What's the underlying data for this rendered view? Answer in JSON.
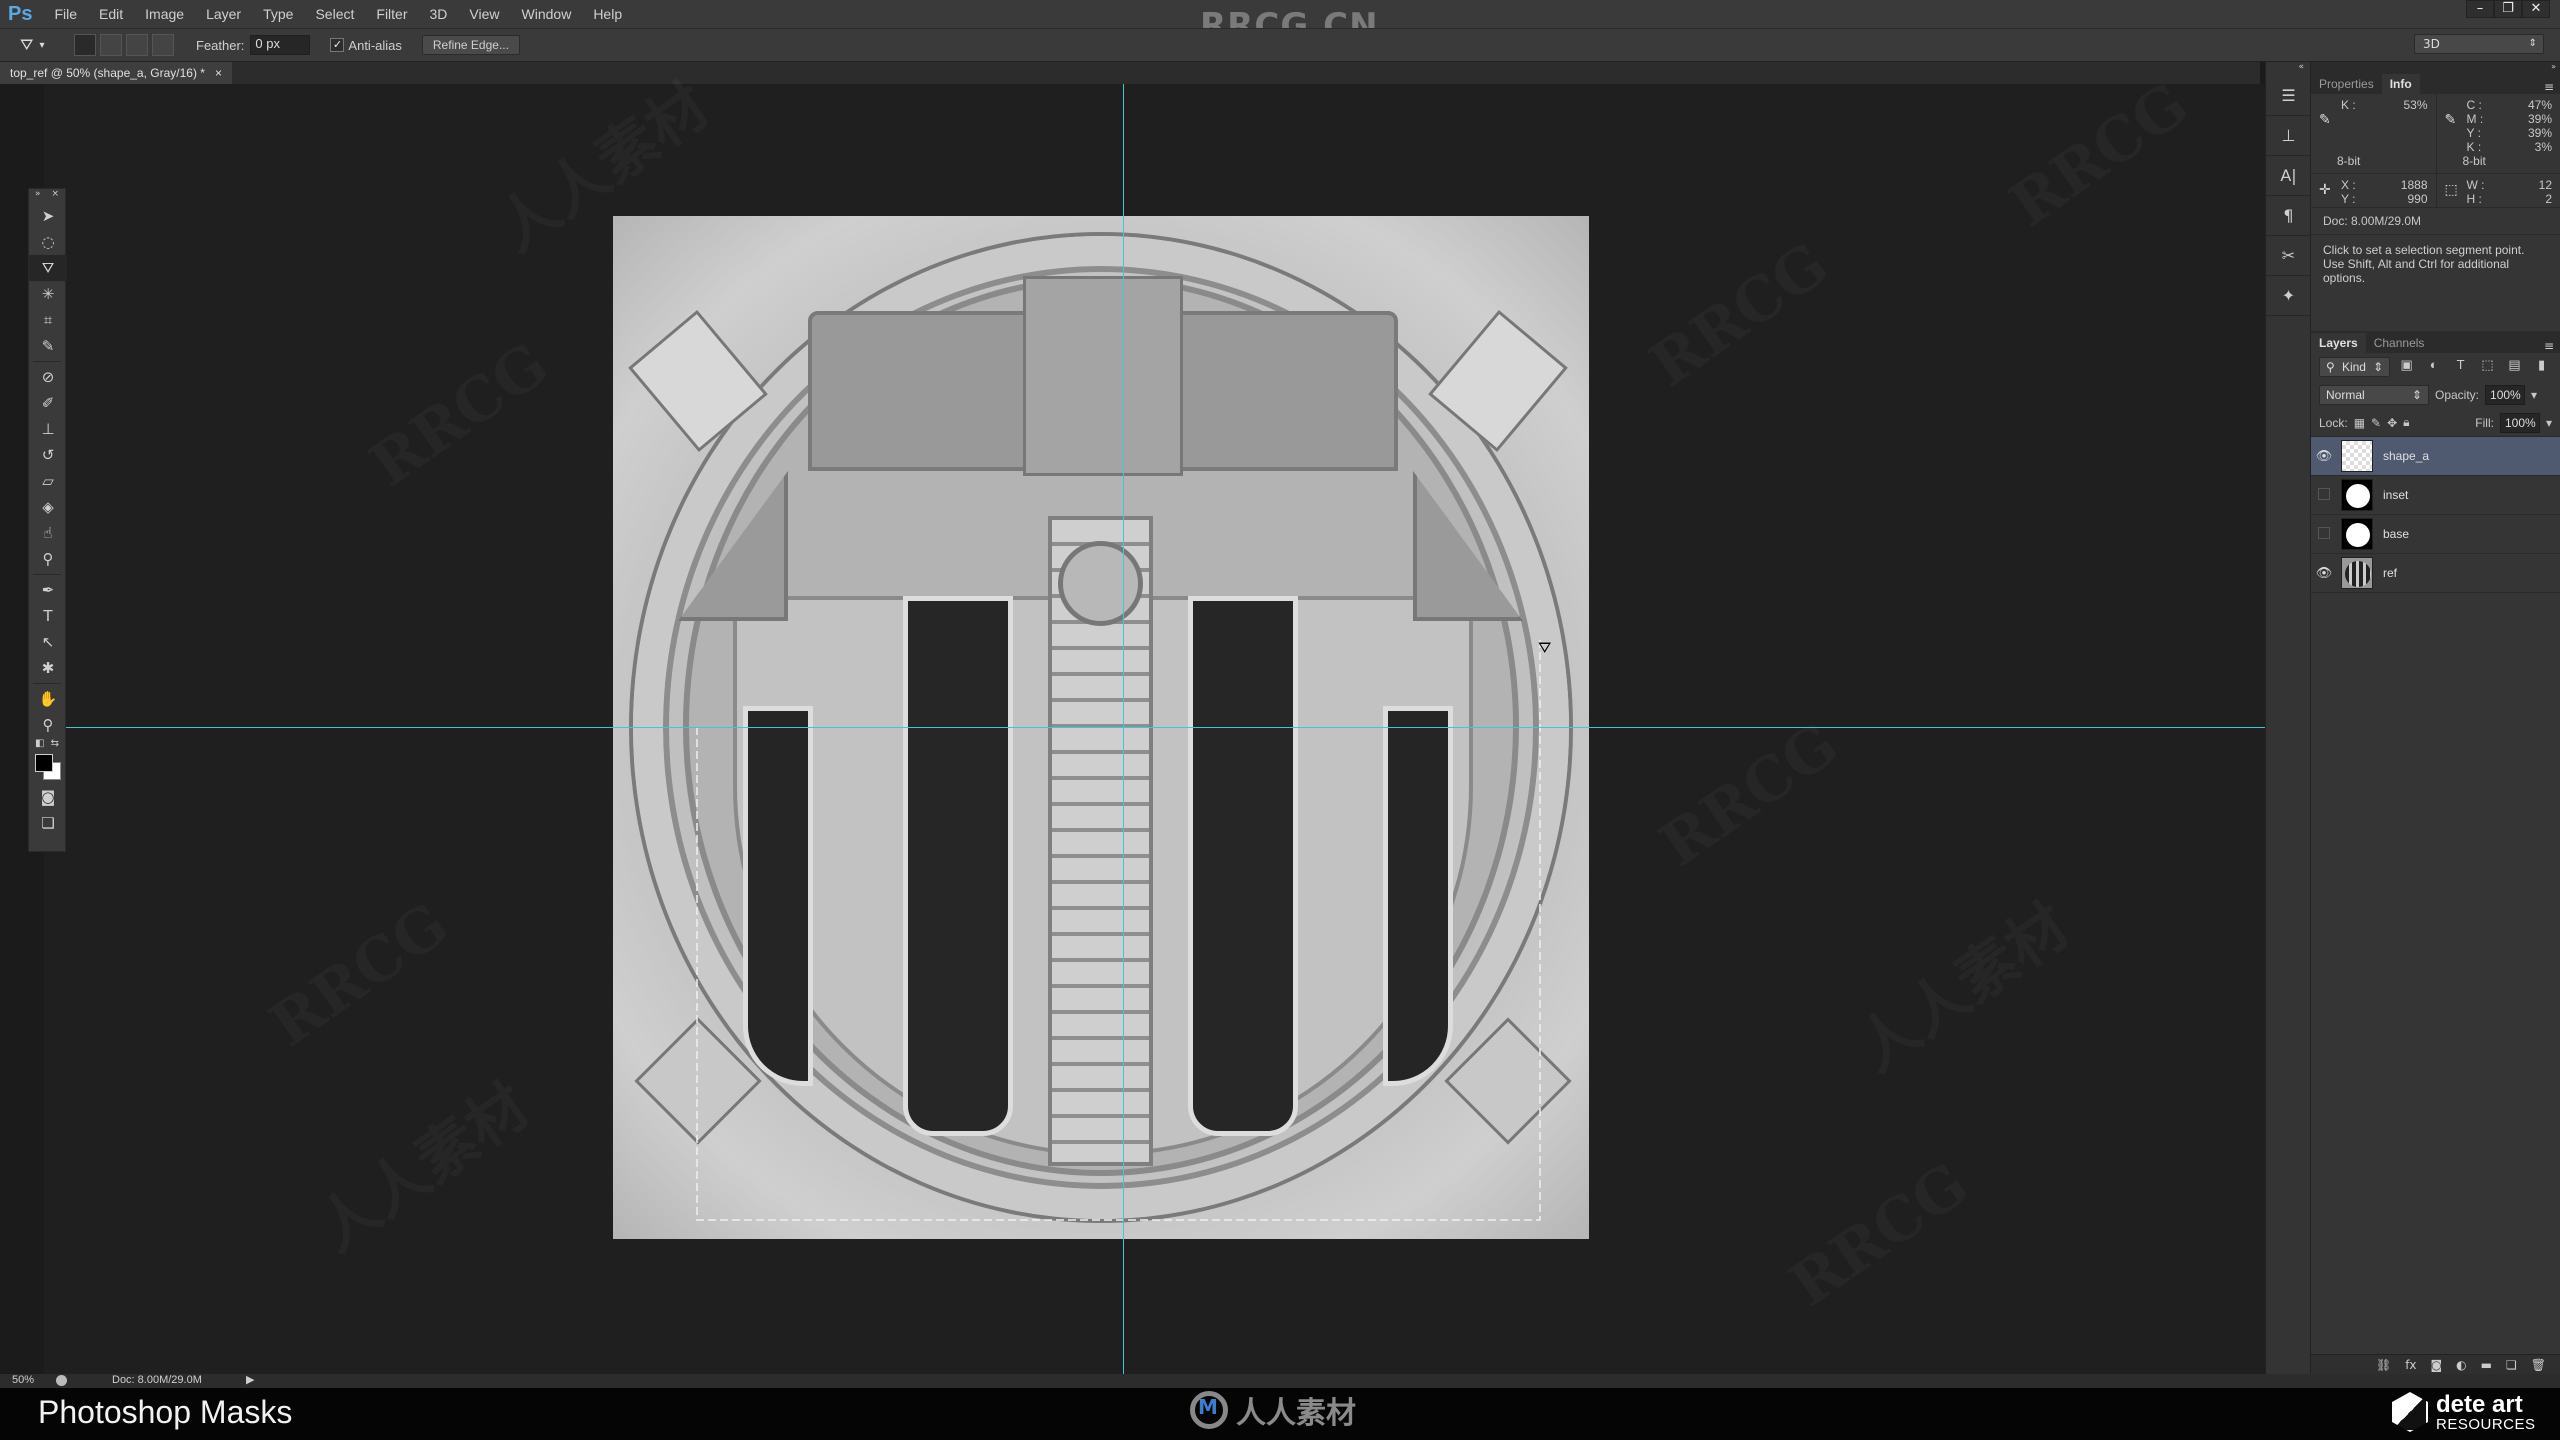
{
  "app": {
    "logo": "Ps",
    "watermark": "RRCG.CN"
  },
  "menu": [
    "File",
    "Edit",
    "Image",
    "Layer",
    "Type",
    "Select",
    "Filter",
    "3D",
    "View",
    "Window",
    "Help"
  ],
  "window_controls": {
    "minimize": "–",
    "restore": "❐",
    "close": "✕"
  },
  "options_bar": {
    "tool_icon": "polygonal-lasso-icon",
    "feather_label": "Feather:",
    "feather_value": "0 px",
    "antialias_label": "Anti-alias",
    "antialias_checked": true,
    "refine_edge_label": "Refine Edge...",
    "workspace": "3D"
  },
  "document_tab": {
    "title": "top_ref @ 50% (shape_a, Gray/16) *",
    "close": "×"
  },
  "toolbox": {
    "tools": [
      "move",
      "elliptical-marquee",
      "polygonal-lasso",
      "magic-wand",
      "crop",
      "eyedropper",
      "spot-healing",
      "brush",
      "clone-stamp",
      "history-brush",
      "eraser",
      "paint-bucket",
      "smudge",
      "dodge",
      "pen",
      "type",
      "path-selection",
      "custom-shape",
      "hand",
      "zoom"
    ],
    "active_tool": "polygonal-lasso",
    "foreground_color": "#000000",
    "background_color": "#ffffff"
  },
  "info_panel": {
    "tabs": [
      "Properties",
      "Info"
    ],
    "active_tab": "Info",
    "gray": {
      "K": "53%",
      "bit": "8-bit"
    },
    "cmyk": {
      "C": "47%",
      "M": "39%",
      "Y": "39%",
      "K": "3%",
      "bit": "8-bit"
    },
    "position": {
      "X": "1888",
      "Y": "990"
    },
    "size": {
      "W": "12",
      "H": "2"
    },
    "doc": "Doc: 8.00M/29.0M",
    "hint": "Click to set a selection segment point. Use Shift, Alt and Ctrl for additional options."
  },
  "layers_panel": {
    "tabs": [
      "Layers",
      "Channels"
    ],
    "active_tab": "Layers",
    "filter": "Kind",
    "blend_mode": "Normal",
    "opacity_label": "Opacity:",
    "opacity": "100%",
    "lock_label": "Lock:",
    "fill_label": "Fill:",
    "fill": "100%",
    "layers": [
      {
        "name": "shape_a",
        "visible": true,
        "selected": true,
        "thumb": "transparent"
      },
      {
        "name": "inset",
        "visible": false,
        "selected": false,
        "thumb": "mask"
      },
      {
        "name": "base",
        "visible": false,
        "selected": false,
        "thumb": "mask"
      },
      {
        "name": "ref",
        "visible": true,
        "selected": false,
        "thumb": "image"
      }
    ]
  },
  "status_bar": {
    "zoom": "50%",
    "doc": "Doc: 8.00M/29.0M"
  },
  "caption": "Photoshop Masks",
  "bottom_logo": "人人素材",
  "brand": {
    "line1": "dete art",
    "line2": "RESOURCES"
  },
  "canvas_watermarks": [
    "RRCG",
    "人人素材"
  ]
}
